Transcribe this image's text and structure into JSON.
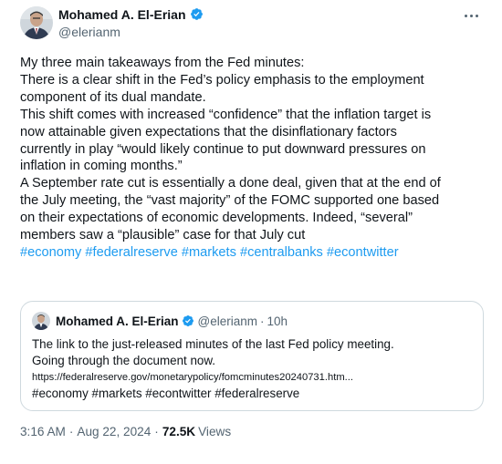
{
  "author": {
    "display_name": "Mohamed A. El-Erian",
    "handle": "@elerianm"
  },
  "tweet": {
    "lines": [
      "My three main takeaways from the Fed minutes:",
      " There is a clear shift in the Fed’s policy emphasis to the employment",
      "component of its dual mandate.",
      " This shift comes with increased “confidence” that the inflation target is",
      "now attainable given expectations that the disinflationary factors",
      "currently in play “would likely continue to put downward pressures on",
      "inflation in coming months.”",
      " A September rate cut is essentially a done deal, given that at the end of",
      "the July meeting, the “vast majority” of the FOMC supported one based",
      "on their expectations of economic developments. Indeed, “several”",
      "members saw a “plausible” case for that July cut"
    ],
    "hashtags": [
      "#economy",
      "#federalreserve",
      "#markets",
      "#centralbanks",
      "#econtwitter"
    ]
  },
  "quote": {
    "display_name": "Mohamed A. El-Erian",
    "handle": "@elerianm",
    "separator": "·",
    "time": "10h",
    "line1": "The link to the just-released minutes of the last Fed policy meeting.",
    "line2": "Going through the document now.",
    "link": "https://federalreserve.gov/monetarypolicy/fomcminutes20240731.htm...",
    "tags": "#economy #markets #econtwitter #federalreserve"
  },
  "meta": {
    "time": "3:16 AM",
    "separator": "·",
    "date": "Aug 22, 2024",
    "views_count": "72.5K",
    "views_label": "Views"
  },
  "icons": {
    "verified": "verified-badge-icon",
    "more": "more-options-icon"
  },
  "colors": {
    "link": "#1d9bf0",
    "secondary_text": "#536471",
    "border": "#cfd9de"
  }
}
